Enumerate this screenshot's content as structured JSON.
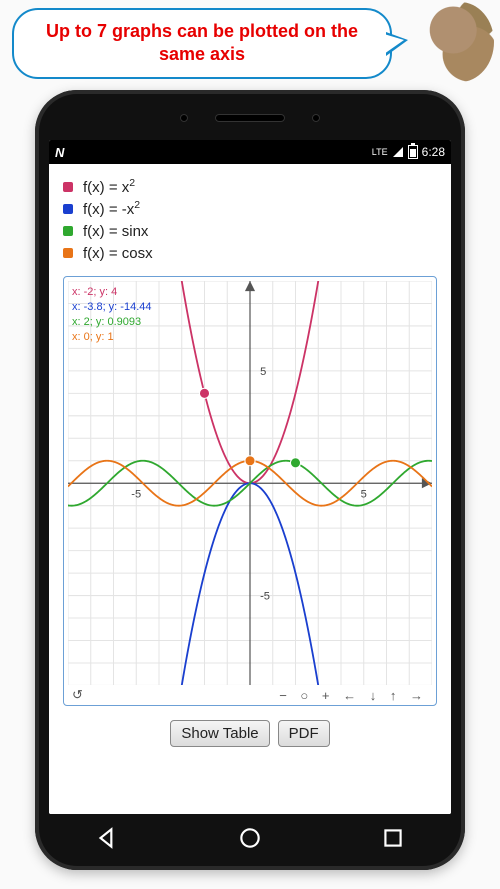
{
  "callout": {
    "text": "Up to 7 graphs can be plotted on the same axis"
  },
  "status": {
    "n_indicator": "N",
    "network": "LTE",
    "time": "6:28"
  },
  "legend": [
    {
      "color": "#cc3366",
      "label": "f(x) = x",
      "sup": "2"
    },
    {
      "color": "#1a3fcf",
      "label": "f(x) = -x",
      "sup": "2"
    },
    {
      "color": "#2fa82f",
      "label": "f(x) = sinx",
      "sup": ""
    },
    {
      "color": "#e87417",
      "label": "f(x) = cosx",
      "sup": ""
    }
  ],
  "readouts": [
    {
      "color": "#cc3366",
      "text": "x: -2; y: 4"
    },
    {
      "color": "#1a3fcf",
      "text": "x: -3.8; y: -14.44"
    },
    {
      "color": "#2fa82f",
      "text": "x: 2; y: 0.9093"
    },
    {
      "color": "#e87417",
      "text": "x: 0; y: 1"
    }
  ],
  "axis": {
    "tick_pos_y": "5",
    "tick_neg_y": "-5",
    "tick_pos_x": "5",
    "tick_neg_x": "-5"
  },
  "markers": {
    "red": {
      "x": -2,
      "y": 4
    },
    "orange": {
      "x": 0,
      "y": 1
    },
    "green": {
      "x": 2,
      "y": 0.9093
    }
  },
  "plot_controls": {
    "reset": "↺",
    "zoom_out": "−",
    "zoom_reset": "○",
    "zoom_in": "+",
    "pan_left": "←",
    "pan_down": "↓",
    "pan_up": "↑",
    "pan_right": "→"
  },
  "buttons": {
    "show_table": "Show Table",
    "pdf": "PDF"
  },
  "chart_data": {
    "type": "line",
    "xlim": [
      -8,
      8
    ],
    "ylim": [
      -9,
      9
    ],
    "grid": true,
    "xlabel": "",
    "ylabel": "",
    "xticks": [
      -5,
      5
    ],
    "yticks": [
      -5,
      5
    ],
    "series": [
      {
        "name": "f(x) = x^2",
        "color": "#cc3366",
        "fn": "x*x"
      },
      {
        "name": "f(x) = -x^2",
        "color": "#1a3fcf",
        "fn": "-x*x"
      },
      {
        "name": "f(x) = sinx",
        "color": "#2fa82f",
        "fn": "sin(x)"
      },
      {
        "name": "f(x) = cosx",
        "color": "#e87417",
        "fn": "cos(x)"
      }
    ],
    "markers": [
      {
        "series": 0,
        "x": -2,
        "y": 4
      },
      {
        "series": 3,
        "x": 0,
        "y": 1
      },
      {
        "series": 2,
        "x": 2,
        "y": 0.9093
      }
    ]
  }
}
